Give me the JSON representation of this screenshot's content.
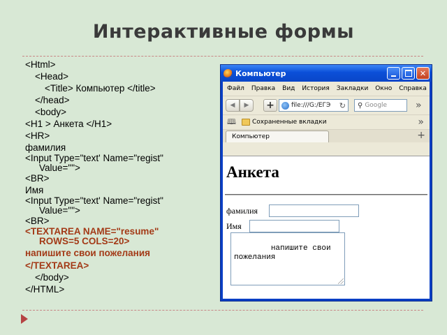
{
  "slide": {
    "title": "Интерактивные формы"
  },
  "code_lines": [
    "<Html>",
    "<Head>",
    "<Title> Компьютер </title>",
    "</head>",
    "<body>",
    "<H1 > Анкета </H1>",
    "<HR>",
    "фамилия",
    "<Input Type=\"text' Name=\"regist\"",
    "Value=\"\">",
    "<BR>",
    "Имя",
    "<Input Type=\"text' Name=\"regist\"",
    "Value=\"\">",
    "<BR>",
    "<TEXTAREA NAME=\"resume\"",
    "ROWS=5 COLS=20>",
    "напишите свои пожелания",
    "</TEXTAREA>",
    "</body>",
    "</HTML>"
  ],
  "browser": {
    "window_title": "Компьютер",
    "menu": [
      "Файл",
      "Правка",
      "Вид",
      "История",
      "Закладки",
      "Окно",
      "Справка"
    ],
    "url": "file:///G:/ЕГЭ",
    "search_placeholder": "Google",
    "bookmark_label": "Сохраненные вкладки",
    "tab_label": "Компьютер",
    "page": {
      "heading": "Анкета",
      "label_surname": "фамилия",
      "label_name": "Имя",
      "textarea_text": "напишите свои\nпожелания"
    }
  },
  "colors": {
    "background": "#d8e8d5",
    "title": "#3a3a3a",
    "textarea_code": "#a33a17",
    "xp_titlebar": "#0b4fd8"
  }
}
